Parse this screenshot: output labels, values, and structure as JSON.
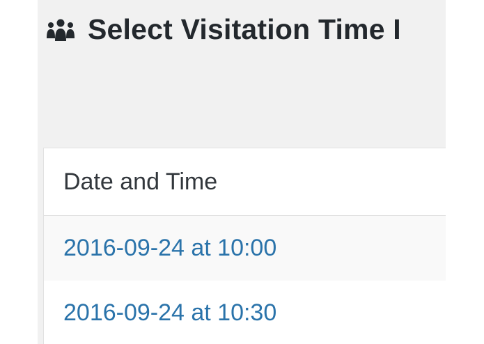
{
  "page": {
    "title": "Select Visitation Time I",
    "title_icon": "groups-icon"
  },
  "table": {
    "columns": [
      "Date and Time"
    ],
    "rows": [
      {
        "date_time": "2016-09-24 at 10:00"
      },
      {
        "date_time": "2016-09-24 at 10:30"
      }
    ]
  },
  "colors": {
    "link": "#2a73aa",
    "heading": "#23282d",
    "background": "#f1f1f1"
  }
}
